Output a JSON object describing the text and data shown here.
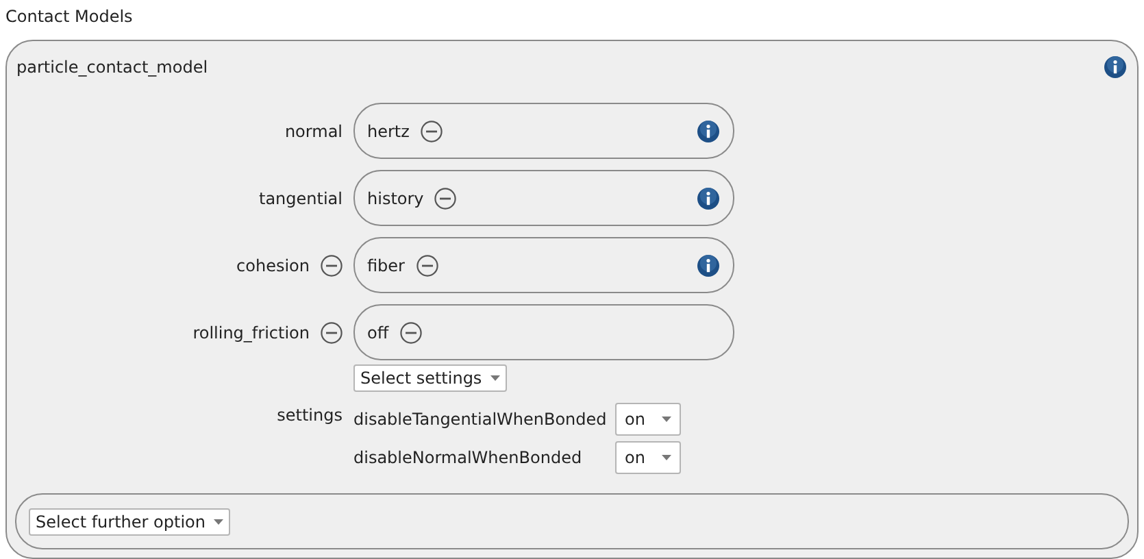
{
  "title": "Contact Models",
  "panel": {
    "title": "particle_contact_model",
    "info": true,
    "models": [
      {
        "label": "normal",
        "label_removable": false,
        "value": "hertz",
        "value_removable": true,
        "info": true
      },
      {
        "label": "tangential",
        "label_removable": false,
        "value": "history",
        "value_removable": true,
        "info": true
      },
      {
        "label": "cohesion",
        "label_removable": true,
        "value": "fiber",
        "value_removable": true,
        "info": true
      },
      {
        "label": "rolling_friction",
        "label_removable": true,
        "value": "off",
        "value_removable": true,
        "info": false
      }
    ],
    "settings": {
      "label": "settings",
      "select": "Select settings",
      "items": [
        {
          "name": "disableTangentialWhenBonded",
          "value": "on"
        },
        {
          "name": "disableNormalWhenBonded",
          "value": "on"
        }
      ]
    },
    "further": "Select further option"
  }
}
